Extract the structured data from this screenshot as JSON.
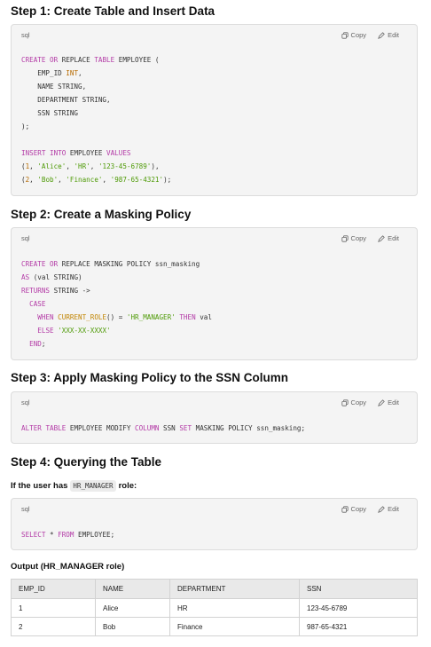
{
  "code_lang": "sql",
  "copy_label": "Copy",
  "edit_label": "Edit",
  "step1": {
    "title": "Step 1: Create Table and Insert Data"
  },
  "step2": {
    "title": "Step 2: Create a Masking Policy"
  },
  "step3": {
    "title": "Step 3: Apply Masking Policy to the SSN Column"
  },
  "step4": {
    "title": "Step 4: Querying the Table",
    "if_user_prefix": "If the user has",
    "role_code": "HR_MANAGER",
    "role_suffix": "role:",
    "output_label": "Output (HR_MANAGER role)"
  },
  "code_blocks": {
    "create_table": [
      [
        [
          "kw",
          "CREATE"
        ],
        [
          "t",
          " "
        ],
        [
          "kw",
          "OR"
        ],
        [
          "t",
          " REPLACE "
        ],
        [
          "kw",
          "TABLE"
        ],
        [
          "t",
          " EMPLOYEE ("
        ]
      ],
      [
        [
          "t",
          "    EMP_ID "
        ],
        [
          "num",
          "INT"
        ],
        [
          "t",
          ","
        ]
      ],
      [
        [
          "t",
          "    NAME STRING,"
        ]
      ],
      [
        [
          "t",
          "    DEPARTMENT STRING,"
        ]
      ],
      [
        [
          "t",
          "    SSN STRING"
        ]
      ],
      [
        [
          "t",
          ");"
        ]
      ],
      [
        [
          "t",
          ""
        ]
      ],
      [
        [
          "kw",
          "INSERT"
        ],
        [
          "t",
          " "
        ],
        [
          "kw",
          "INTO"
        ],
        [
          "t",
          " EMPLOYEE "
        ],
        [
          "kw",
          "VALUES"
        ]
      ],
      [
        [
          "t",
          "("
        ],
        [
          "num",
          "1"
        ],
        [
          "t",
          ", "
        ],
        [
          "str",
          "'Alice'"
        ],
        [
          "t",
          ", "
        ],
        [
          "str",
          "'HR'"
        ],
        [
          "t",
          ", "
        ],
        [
          "str",
          "'123-45-6789'"
        ],
        [
          "t",
          "),"
        ]
      ],
      [
        [
          "t",
          "("
        ],
        [
          "num",
          "2"
        ],
        [
          "t",
          ", "
        ],
        [
          "str",
          "'Bob'"
        ],
        [
          "t",
          ", "
        ],
        [
          "str",
          "'Finance'"
        ],
        [
          "t",
          ", "
        ],
        [
          "str",
          "'987-65-4321'"
        ],
        [
          "t",
          ");"
        ]
      ]
    ],
    "masking_policy": [
      [
        [
          "kw",
          "CREATE"
        ],
        [
          "t",
          " "
        ],
        [
          "kw",
          "OR"
        ],
        [
          "t",
          " REPLACE MASKING POLICY ssn_masking"
        ]
      ],
      [
        [
          "kw",
          "AS"
        ],
        [
          "t",
          " (val STRING)"
        ]
      ],
      [
        [
          "kw",
          "RETURNS"
        ],
        [
          "t",
          " STRING ->"
        ]
      ],
      [
        [
          "t",
          "  "
        ],
        [
          "kw",
          "CASE"
        ]
      ],
      [
        [
          "t",
          "    "
        ],
        [
          "kw",
          "WHEN"
        ],
        [
          "t",
          " "
        ],
        [
          "fn",
          "CURRENT_ROLE"
        ],
        [
          "t",
          "() = "
        ],
        [
          "str",
          "'HR_MANAGER'"
        ],
        [
          "t",
          " "
        ],
        [
          "kw",
          "THEN"
        ],
        [
          "t",
          " val"
        ]
      ],
      [
        [
          "t",
          "    "
        ],
        [
          "kw",
          "ELSE"
        ],
        [
          "t",
          " "
        ],
        [
          "str",
          "'XXX-XX-XXXX'"
        ]
      ],
      [
        [
          "t",
          "  "
        ],
        [
          "kw",
          "END"
        ],
        [
          "t",
          ";"
        ]
      ]
    ],
    "alter_table": [
      [
        [
          "kw",
          "ALTER"
        ],
        [
          "t",
          " "
        ],
        [
          "kw",
          "TABLE"
        ],
        [
          "t",
          " EMPLOYEE MODIFY "
        ],
        [
          "kw",
          "COLUMN"
        ],
        [
          "t",
          " SSN "
        ],
        [
          "kw",
          "SET"
        ],
        [
          "t",
          " MASKING POLICY ssn_masking;"
        ]
      ]
    ],
    "select_query": [
      [
        [
          "kw",
          "SELECT"
        ],
        [
          "t",
          " * "
        ],
        [
          "kw",
          "FROM"
        ],
        [
          "t",
          " EMPLOYEE;"
        ]
      ]
    ]
  },
  "output_table": {
    "headers": [
      "EMP_ID",
      "NAME",
      "DEPARTMENT",
      "SSN"
    ],
    "rows": [
      [
        "1",
        "Alice",
        "HR",
        "123-45-6789"
      ],
      [
        "2",
        "Bob",
        "Finance",
        "987-65-4321"
      ]
    ]
  }
}
